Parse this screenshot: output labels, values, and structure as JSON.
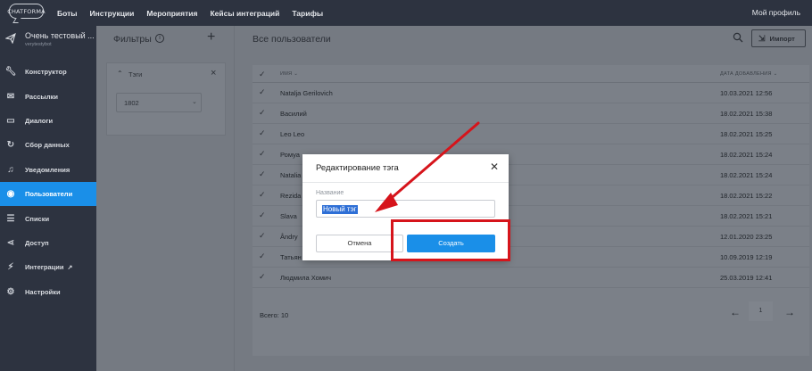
{
  "brand": {
    "logo_text": "CHATFORMA"
  },
  "topnav": {
    "items": [
      "Боты",
      "Инструкции",
      "Мероприятия",
      "Кейсы интеграций",
      "Тарифы"
    ],
    "profile": "Мой профиль"
  },
  "project": {
    "name": "Очень тестовый ...",
    "subtitle": "verytestybot"
  },
  "sidebar": {
    "items": [
      {
        "label": "Конструктор",
        "icon": "wrench-icon"
      },
      {
        "label": "Рассылки",
        "icon": "mail-icon"
      },
      {
        "label": "Диалоги",
        "icon": "chat-icon"
      },
      {
        "label": "Сбор данных",
        "icon": "refresh-icon"
      },
      {
        "label": "Уведомления",
        "icon": "bell-icon"
      },
      {
        "label": "Пользователи",
        "icon": "eye-icon",
        "active": true
      },
      {
        "label": "Списки",
        "icon": "list-icon"
      },
      {
        "label": "Доступ",
        "icon": "share-icon"
      },
      {
        "label": "Интеграции",
        "icon": "plug-icon"
      },
      {
        "label": "Настройки",
        "icon": "gear-icon"
      }
    ]
  },
  "filters": {
    "title": "Фильтры",
    "card": {
      "title": "Тэги",
      "selected": "1802"
    }
  },
  "main": {
    "title": "Все пользователи",
    "import_label": "Импорт",
    "columns": {
      "name": "ИМЯ",
      "date": "ДАТА ДОБАВЛЕНИЯ"
    },
    "rows": [
      {
        "name": "Natalja Gerilovich",
        "date": "10.03.2021 12:56"
      },
      {
        "name": "Василий",
        "date": "18.02.2021 15:38"
      },
      {
        "name": "Leo Leo",
        "date": "18.02.2021 15:25"
      },
      {
        "name": "Ромуа",
        "date": "18.02.2021 15:24"
      },
      {
        "name": "Natalia",
        "date": "18.02.2021 15:24"
      },
      {
        "name": "Rezida",
        "date": "18.02.2021 15:22"
      },
      {
        "name": "Slava",
        "date": "18.02.2021 15:21"
      },
      {
        "name": "Ândry",
        "date": "12.01.2020 23:25"
      },
      {
        "name": "Татьян",
        "date": "10.09.2019 12:19"
      },
      {
        "name": "Людмила Хомич",
        "date": "25.03.2019 12:41"
      }
    ],
    "total": "Всего: 10",
    "page": "1"
  },
  "modal": {
    "title": "Редактирование тэга",
    "field_label": "Название",
    "field_value": "Новый тэг",
    "cancel_label": "Отмена",
    "create_label": "Создать"
  },
  "colors": {
    "accent": "#1a8fe8",
    "sidebar": "#2d3340",
    "annotation": "#d6141b"
  }
}
